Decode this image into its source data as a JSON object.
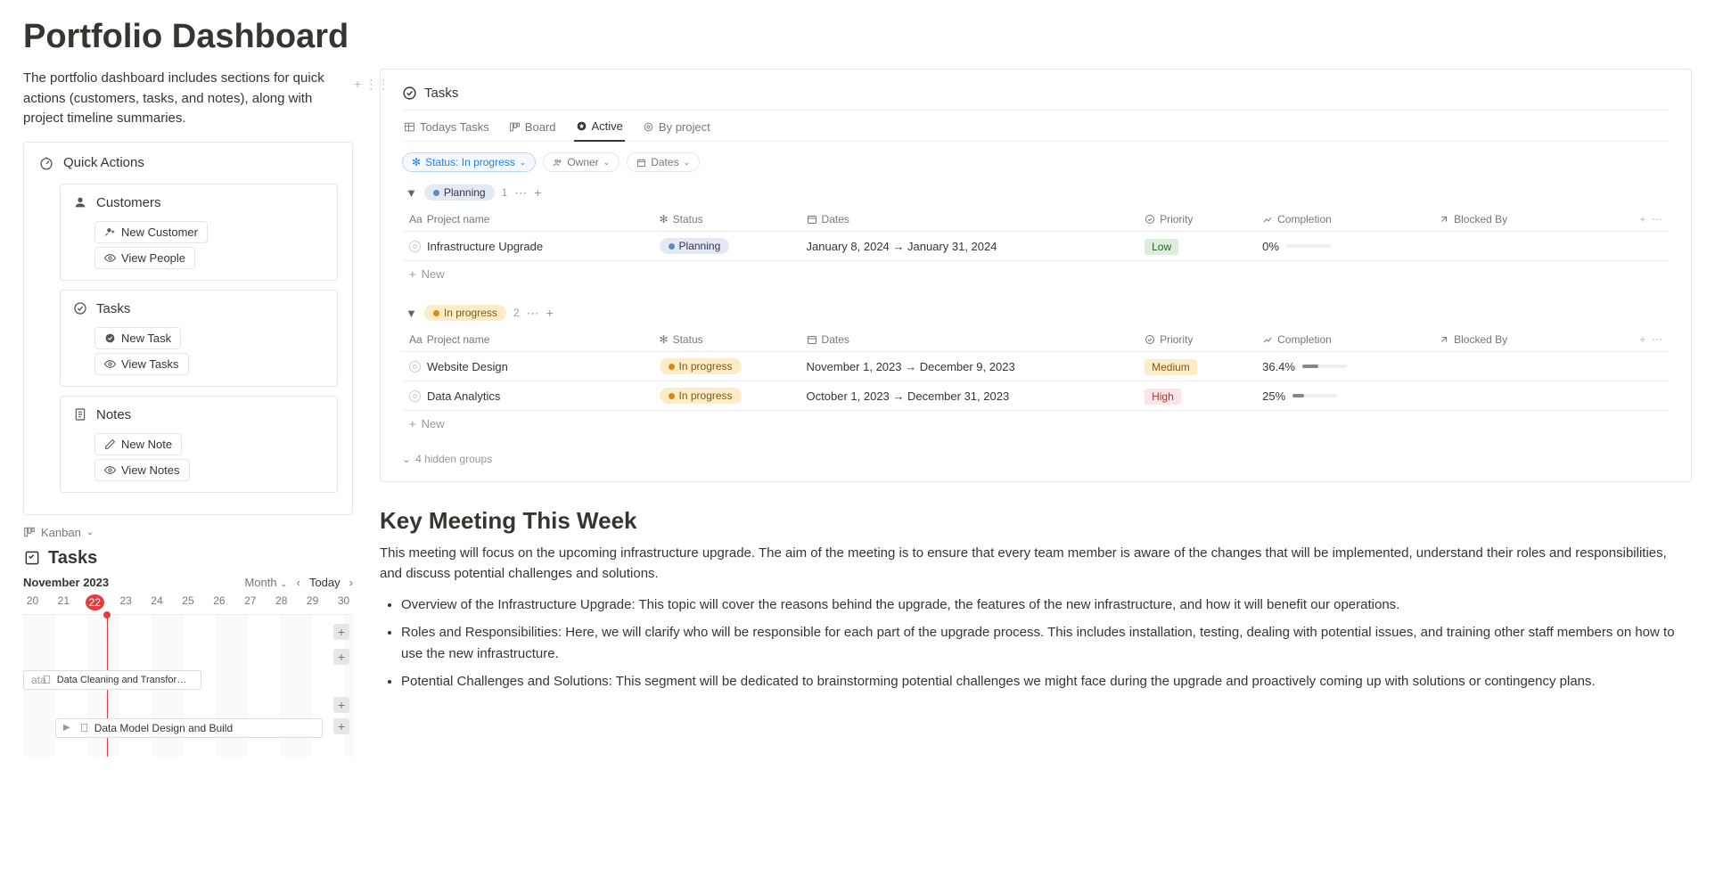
{
  "page": {
    "title": "Portfolio Dashboard",
    "description": "The portfolio dashboard includes sections for quick actions (customers, tasks, and notes), along with project timeline summaries."
  },
  "quickActions": {
    "title": "Quick Actions",
    "customers": {
      "title": "Customers",
      "newLabel": "New Customer",
      "viewLabel": "View People"
    },
    "tasks": {
      "title": "Tasks",
      "newLabel": "New Task",
      "viewLabel": "View Tasks"
    },
    "notes": {
      "title": "Notes",
      "newLabel": "New Note",
      "viewLabel": "View Notes"
    }
  },
  "kanban": {
    "label": "Kanban"
  },
  "leftTasks": {
    "title": "Tasks",
    "monthLabel": "November 2023",
    "scaleLabel": "Month",
    "todayLabel": "Today",
    "dates": [
      "20",
      "21",
      "22",
      "23",
      "24",
      "25",
      "26",
      "27",
      "28",
      "29",
      "30"
    ],
    "todayIndex": 2,
    "bar1Label": "Data Cleaning and Transformation",
    "bar1Prefix": "ata",
    "bar2Label": "Data Model Design and Build"
  },
  "tasksPanel": {
    "title": "Tasks",
    "tabs": {
      "todays": "Todays Tasks",
      "board": "Board",
      "active": "Active",
      "byProject": "By project"
    },
    "filters": {
      "status": "Status: In progress",
      "owner": "Owner",
      "dates": "Dates"
    },
    "columns": {
      "project": "Project name",
      "status": "Status",
      "dates": "Dates",
      "priority": "Priority",
      "completion": "Completion",
      "blockedBy": "Blocked By"
    },
    "newLabel": "New",
    "hiddenGroups": "4 hidden groups",
    "planningGroup": {
      "label": "Planning",
      "count": "1",
      "rows": [
        {
          "name": "Infrastructure Upgrade",
          "status": "Planning",
          "dates": "January 8, 2024 → January 31, 2024",
          "priority": "Low",
          "completion": "0%",
          "completionPct": 0
        }
      ]
    },
    "inProgressGroup": {
      "label": "In progress",
      "count": "2",
      "rows": [
        {
          "name": "Website Design",
          "status": "In progress",
          "dates": "November 1, 2023 → December 9, 2023",
          "priority": "Medium",
          "completion": "36.4%",
          "completionPct": 36.4
        },
        {
          "name": "Data Analytics",
          "status": "In progress",
          "dates": "October 1, 2023 → December 31, 2023",
          "priority": "High",
          "completion": "25%",
          "completionPct": 25
        }
      ]
    }
  },
  "meeting": {
    "title": "Key Meeting This Week",
    "intro": "This meeting will focus on the upcoming infrastructure upgrade. The aim of the meeting is to ensure that every team member is aware of the changes that will be implemented, understand their roles and responsibilities, and discuss potential challenges and solutions.",
    "bullets": [
      "Overview of the Infrastructure Upgrade: This topic will cover the reasons behind the upgrade, the features of the new infrastructure, and how it will benefit our operations.",
      "Roles and Responsibilities: Here, we will clarify who will be responsible for each part of the upgrade process. This includes installation, testing, dealing with potential issues, and training other staff members on how to use the new infrastructure.",
      "Potential Challenges and Solutions: This segment will be dedicated to brainstorming potential challenges we might face during the upgrade and proactively coming up with solutions or contingency plans."
    ]
  }
}
